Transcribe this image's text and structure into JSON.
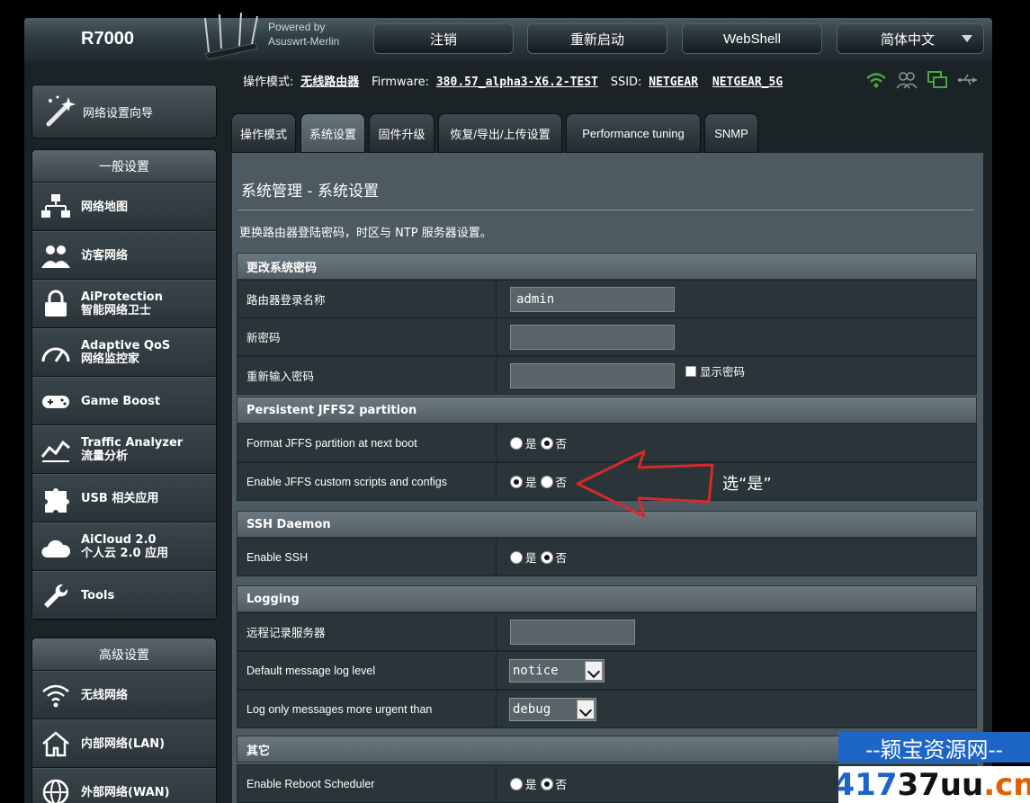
{
  "header": {
    "model": "R7000",
    "powered_line1": "Powered by",
    "powered_line2": "Asuswrt-Merlin",
    "buttons": {
      "logout": "注销",
      "reboot": "重新启动",
      "webshell": "WebShell",
      "language": "简体中文"
    }
  },
  "status": {
    "mode_label": "操作模式:",
    "mode_value": "无线路由器",
    "firmware_label": "Firmware:",
    "firmware_value": "380.57_alpha3-X6.2-TEST",
    "ssid_label": "SSID:",
    "ssid_1": "NETGEAR",
    "ssid_2": "NETGEAR_5G",
    "icons": [
      "wifi-icon",
      "clients-icon",
      "network-icon",
      "usb-icon"
    ]
  },
  "sidebar": {
    "wizard": "网络设置向导",
    "general_head": "一般设置",
    "general_items": [
      {
        "label": "网络地图",
        "label2": "",
        "icon": "network-map-icon"
      },
      {
        "label": "访客网络",
        "label2": "",
        "icon": "guest-network-icon"
      },
      {
        "label": "AiProtection",
        "label2": "智能网络卫士",
        "icon": "lock-icon"
      },
      {
        "label": "Adaptive QoS",
        "label2": "网络监控家",
        "icon": "gauge-icon"
      },
      {
        "label": "Game Boost",
        "label2": "",
        "icon": "gamepad-icon"
      },
      {
        "label": "Traffic Analyzer",
        "label2": "流量分析",
        "icon": "chart-icon"
      },
      {
        "label": "USB 相关应用",
        "label2": "",
        "icon": "puzzle-icon"
      },
      {
        "label": "AiCloud 2.0",
        "label2": "个人云 2.0 应用",
        "icon": "cloud-icon"
      },
      {
        "label": "Tools",
        "label2": "",
        "icon": "wrench-icon"
      }
    ],
    "advanced_head": "高级设置",
    "advanced_items": [
      {
        "label": "无线网络",
        "icon": "wireless-icon"
      },
      {
        "label": "内部网络(LAN)",
        "icon": "home-icon"
      },
      {
        "label": "外部网络(WAN)",
        "icon": "globe-icon"
      }
    ]
  },
  "tabs": [
    "操作模式",
    "系统设置",
    "固件升级",
    "恢复/导出/上传设置",
    "Performance tuning",
    "SNMP"
  ],
  "active_tab": "系统设置",
  "page": {
    "title": "系统管理 - 系统设置",
    "description": "更换路由器登陆密码，时区与 NTP 服务器设置。"
  },
  "sections": {
    "password": {
      "head": "更改系统密码",
      "login_label": "路由器登录名称",
      "login_value": "admin",
      "new_pw_label": "新密码",
      "new_pw_value": "",
      "retype_label": "重新输入密码",
      "retype_value": "",
      "show_pw": "显示密码"
    },
    "jffs": {
      "head": "Persistent JFFS2 partition",
      "format_label": "Format JFFS partition at next boot",
      "format_value": "否",
      "scripts_label": "Enable JFFS custom scripts and configs",
      "scripts_value": "是"
    },
    "ssh": {
      "head": "SSH Daemon",
      "enable_label": "Enable SSH",
      "enable_value": "否"
    },
    "logging": {
      "head": "Logging",
      "remote_label": "远程记录服务器",
      "remote_value": "",
      "level_label": "Default message log level",
      "level_value": "notice",
      "urgent_label": "Log only messages more urgent than",
      "urgent_value": "debug"
    },
    "other": {
      "head": "其它",
      "reboot_label": "Enable Reboot Scheduler",
      "reboot_value": "否"
    }
  },
  "radio_labels": {
    "yes": "是",
    "no": "否"
  },
  "annotation": "选“是”",
  "watermark": {
    "top": "--颖宝资源网--",
    "num": "417",
    "mid": "37uu",
    "tld": ".cn"
  },
  "colors": {
    "accent": "#4ca83a",
    "arrow": "#d42a2a",
    "panel": "#4d5a62",
    "row": "#2b3539"
  }
}
